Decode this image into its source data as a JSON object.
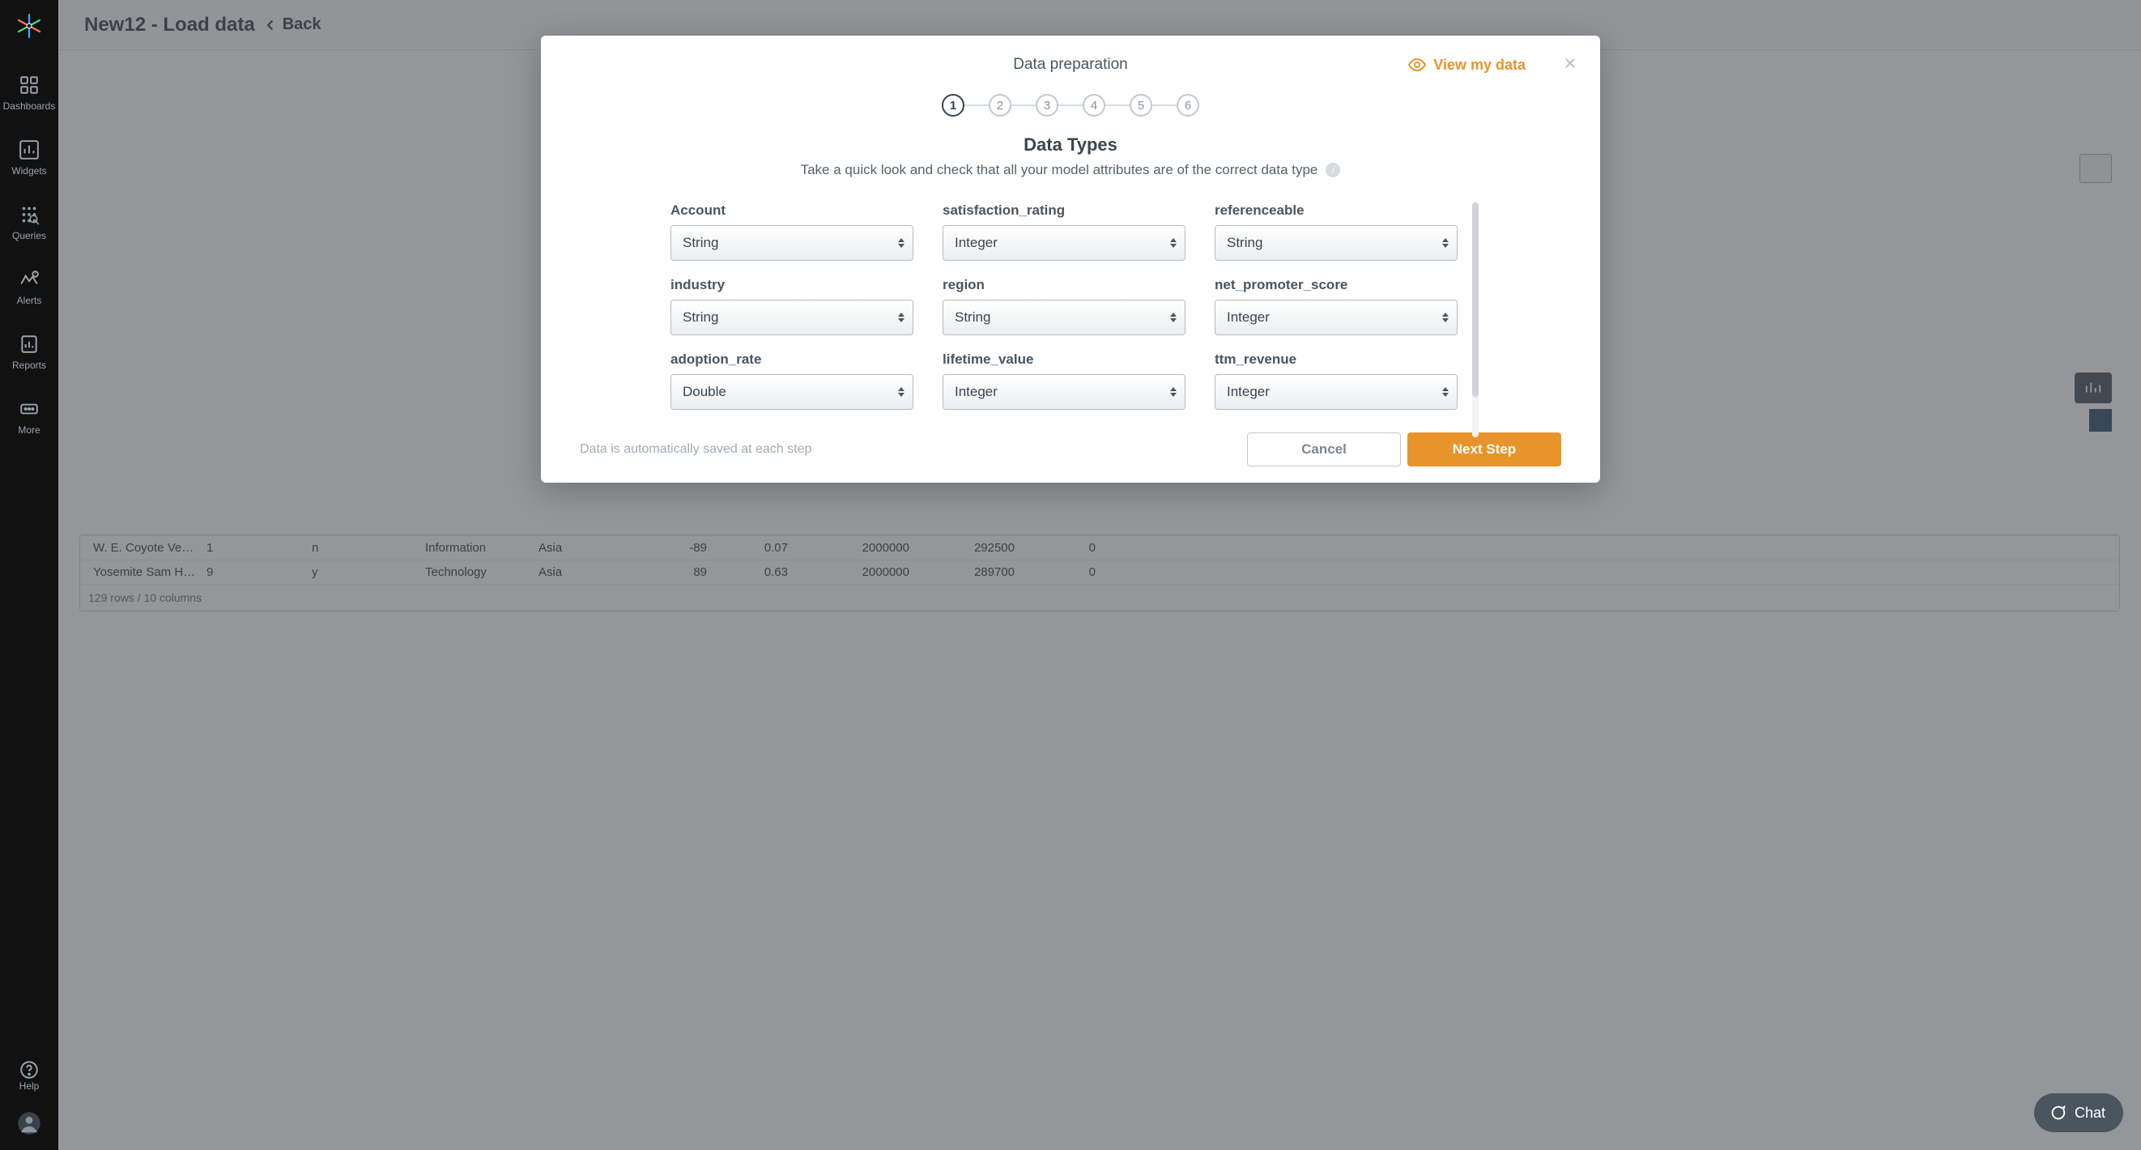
{
  "sidebar": {
    "items": [
      {
        "label": "Dashboards"
      },
      {
        "label": "Widgets"
      },
      {
        "label": "Queries"
      },
      {
        "label": "Alerts"
      },
      {
        "label": "Reports"
      },
      {
        "label": "More"
      }
    ],
    "help_label": "Help"
  },
  "page": {
    "title": "New12 - Load data",
    "back_label": "Back"
  },
  "modal": {
    "top_title": "Data preparation",
    "view_label": "View my data",
    "steps": [
      "1",
      "2",
      "3",
      "4",
      "5",
      "6"
    ],
    "active_step": "1",
    "section_title": "Data Types",
    "section_subtitle": "Take a quick look and check that all your model attributes are of the correct data type",
    "fields": [
      {
        "label": "Account",
        "value": "String"
      },
      {
        "label": "satisfaction_rating",
        "value": "Integer"
      },
      {
        "label": "referenceable",
        "value": "String"
      },
      {
        "label": "industry",
        "value": "String"
      },
      {
        "label": "region",
        "value": "String"
      },
      {
        "label": "net_promoter_score",
        "value": "Integer"
      },
      {
        "label": "adoption_rate",
        "value": "Double"
      },
      {
        "label": "lifetime_value",
        "value": "Integer"
      },
      {
        "label": "ttm_revenue",
        "value": "Integer"
      }
    ],
    "save_note": "Data is automatically saved at each step",
    "cancel_label": "Cancel",
    "next_label": "Next Step"
  },
  "table": {
    "rows": [
      {
        "c0": "W. E. Coyote Vent…",
        "c1": "1",
        "c2": "n",
        "c3": "Information",
        "c4": "Asia",
        "c5": "-89",
        "c6": "0.07",
        "c7": "2000000",
        "c8": "292500",
        "c9": "0"
      },
      {
        "c0": "Yosemite Sam Har…",
        "c1": "9",
        "c2": "y",
        "c3": "Technology",
        "c4": "Asia",
        "c5": "89",
        "c6": "0.63",
        "c7": "2000000",
        "c8": "289700",
        "c9": "0"
      }
    ],
    "footer": "129 rows / 10 columns"
  },
  "chat": {
    "label": "Chat"
  }
}
